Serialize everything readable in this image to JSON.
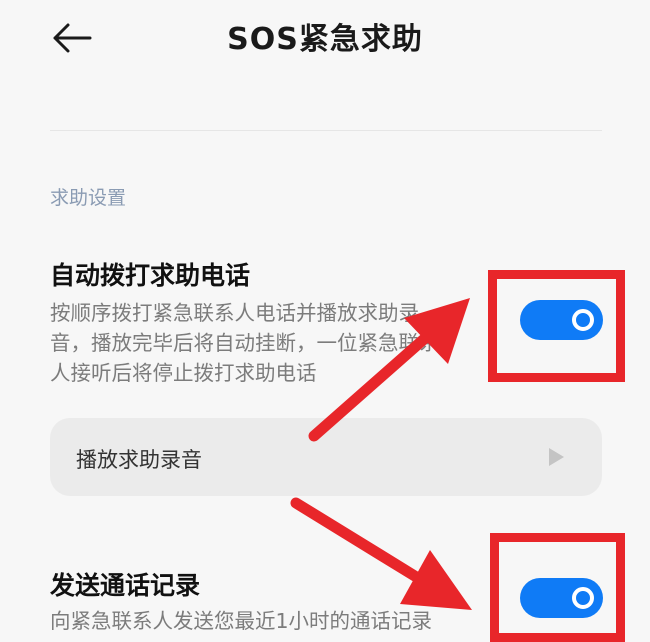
{
  "header": {
    "title": "SOS紧急求助",
    "back_icon": "arrow-left-icon"
  },
  "section": {
    "label": "求助设置"
  },
  "settings": [
    {
      "title": "自动拨打求助电话",
      "desc_lines": [
        "按顺序拨打紧急联系人电话并播放求助录",
        "音，播放完毕后将自动挂断，一位紧急联系",
        "人接听后将停止拨打求助电话"
      ],
      "enabled": true
    },
    {
      "title": "发送通话记录",
      "desc_lines": [
        "向紧急联系人发送您最近1小时的通话记录"
      ],
      "enabled": true
    }
  ],
  "play_card": {
    "label": "播放求助录音",
    "icon": "play-icon"
  },
  "colors": {
    "toggle_on": "#0f7bf6",
    "annotation": "#e8262a",
    "section_label": "#8a9bb3"
  }
}
